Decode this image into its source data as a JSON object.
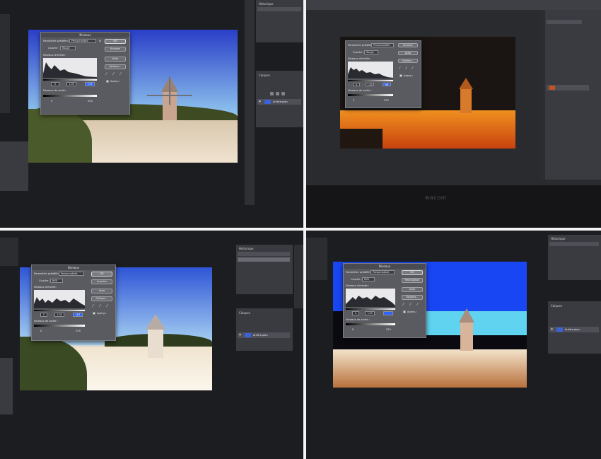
{
  "levels": {
    "title": "Niveaux",
    "preset_label": "Paramètre prédéfini :",
    "preset_value": "Personnalisée",
    "channel_label": "Couche :",
    "input_label": "Niveaux d'entrée :",
    "output_label": "Niveaux de sortie :",
    "ok": "OK",
    "cancel": "Annuler",
    "reset": "Réinitialiser",
    "auto": "Auto",
    "options": "Options...",
    "preview": "Aperçu",
    "gamma": "1,00",
    "black_in": "0",
    "out_black": "0",
    "out_white": "255"
  },
  "screens": [
    {
      "id": "top-left",
      "channel": "Rouge",
      "white_in": "174",
      "file": "",
      "layer": "Arrière-plan",
      "panel": "Historique",
      "layers_panel": "Calques",
      "history_items": [
        "",
        "",
        "",
        ""
      ],
      "colors": {
        "sky_top": "#2a3fc8",
        "sky_bottom": "#8fc4ee",
        "ground": "#d9c8ae",
        "trees": "#3d4a22",
        "mill": "#c9a58f"
      }
    },
    {
      "id": "top-right",
      "channel": "Rouge",
      "white_in": "98",
      "file": "",
      "layer": "",
      "panel": "",
      "layers_panel": "",
      "history_items": [],
      "colors": {
        "sky_top": "#1a1512",
        "sky_bottom": "#1a1512",
        "ground": "#e46a12",
        "trees": "#201710",
        "mill": "#d77a2a"
      }
    },
    {
      "id": "bottom-left",
      "channel": "RVB",
      "white_in": "183",
      "file": "",
      "layer": "Arrière-plan",
      "panel": "Historique",
      "layers_panel": "Calques",
      "history_items": [
        "",
        "",
        "",
        ""
      ],
      "colors": {
        "sky_top": "#2f55d6",
        "sky_bottom": "#a9d3f2",
        "ground": "#f0e4cf",
        "trees": "#2e3b1c",
        "mill": "#e9ddcf"
      }
    },
    {
      "id": "bottom-right",
      "channel": "RVB",
      "white_in": "",
      "file": "",
      "layer": "Arrière-plan",
      "panel": "Historique",
      "layers_panel": "Calques",
      "history_items": [
        "",
        "",
        "",
        ""
      ],
      "colors": {
        "sky_top": "#1846f2",
        "sky_bottom": "#5fd3ef",
        "ground": "#e8c9a6",
        "trees": "#0b0a10",
        "mill": "#d8b49a"
      }
    }
  ],
  "watermark": "wacom"
}
